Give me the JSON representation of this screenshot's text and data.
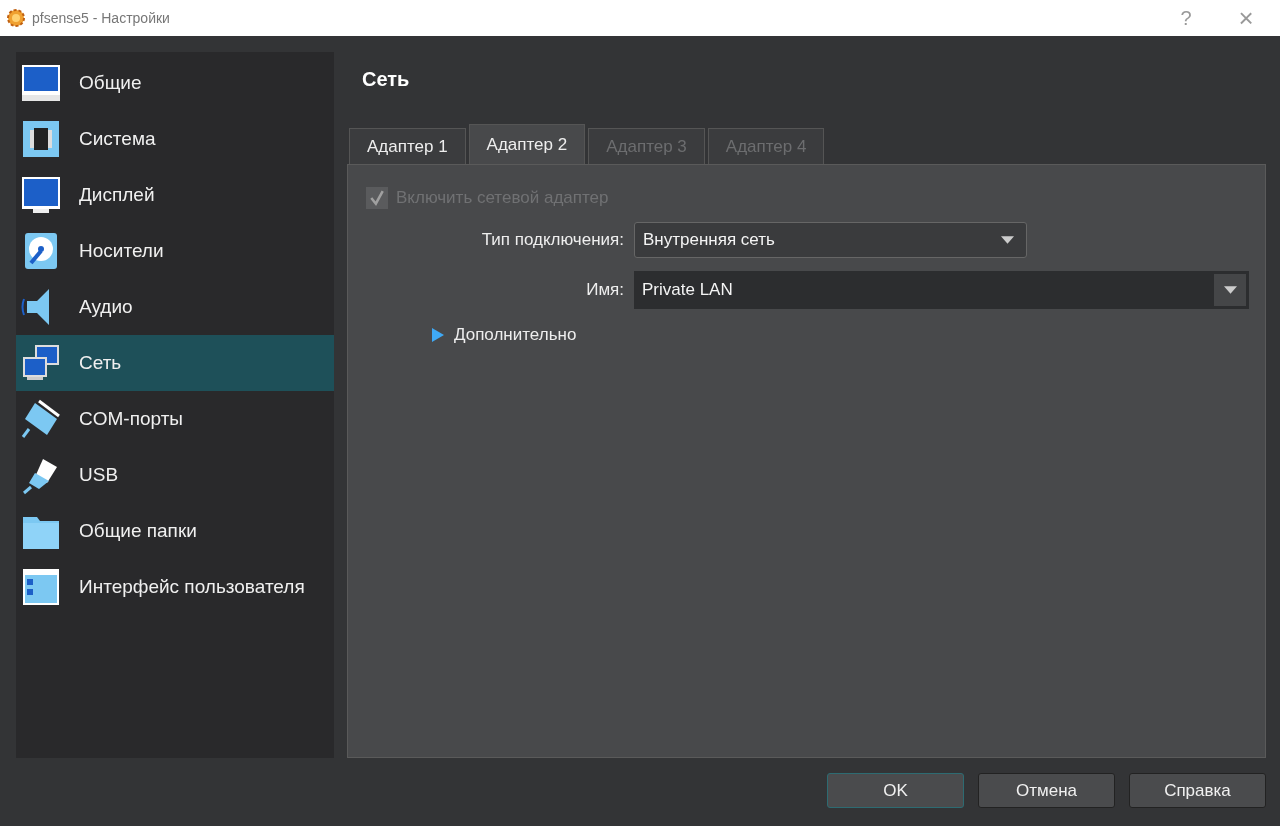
{
  "window": {
    "title": "pfsense5 - Настройки",
    "help": "?",
    "close": "×"
  },
  "sidebar": {
    "items": [
      {
        "label": "Общие",
        "kind": "general",
        "selected": false
      },
      {
        "label": "Система",
        "kind": "system",
        "selected": false
      },
      {
        "label": "Дисплей",
        "kind": "display",
        "selected": false
      },
      {
        "label": "Носители",
        "kind": "storage",
        "selected": false
      },
      {
        "label": "Аудио",
        "kind": "audio",
        "selected": false
      },
      {
        "label": "Сеть",
        "kind": "network",
        "selected": true
      },
      {
        "label": "COM-порты",
        "kind": "serial",
        "selected": false
      },
      {
        "label": "USB",
        "kind": "usb",
        "selected": false
      },
      {
        "label": "Общие папки",
        "kind": "folder",
        "selected": false
      },
      {
        "label": "Интерфейс пользователя",
        "kind": "ui",
        "selected": false
      }
    ]
  },
  "page": {
    "title": "Сеть",
    "tabs": [
      {
        "label": "Адаптер 1",
        "selected": false,
        "disabled": false
      },
      {
        "label": "Адаптер 2",
        "selected": true,
        "disabled": false
      },
      {
        "label": "Адаптер 3",
        "selected": false,
        "disabled": true
      },
      {
        "label": "Адаптер 4",
        "selected": false,
        "disabled": true
      }
    ],
    "enable_adapter": {
      "label": "Включить сетевой адаптер",
      "checked": true,
      "disabled": true
    },
    "attached_to": {
      "label": "Тип подключения:",
      "value": "Внутренняя сеть"
    },
    "name": {
      "label": "Имя:",
      "value": "Private LAN"
    },
    "advanced": {
      "label": "Дополнительно",
      "expanded": false
    }
  },
  "buttons": [
    {
      "label": "OK",
      "default": true
    },
    {
      "label": "Отмена",
      "default": false
    },
    {
      "label": "Справка",
      "default": false
    }
  ]
}
